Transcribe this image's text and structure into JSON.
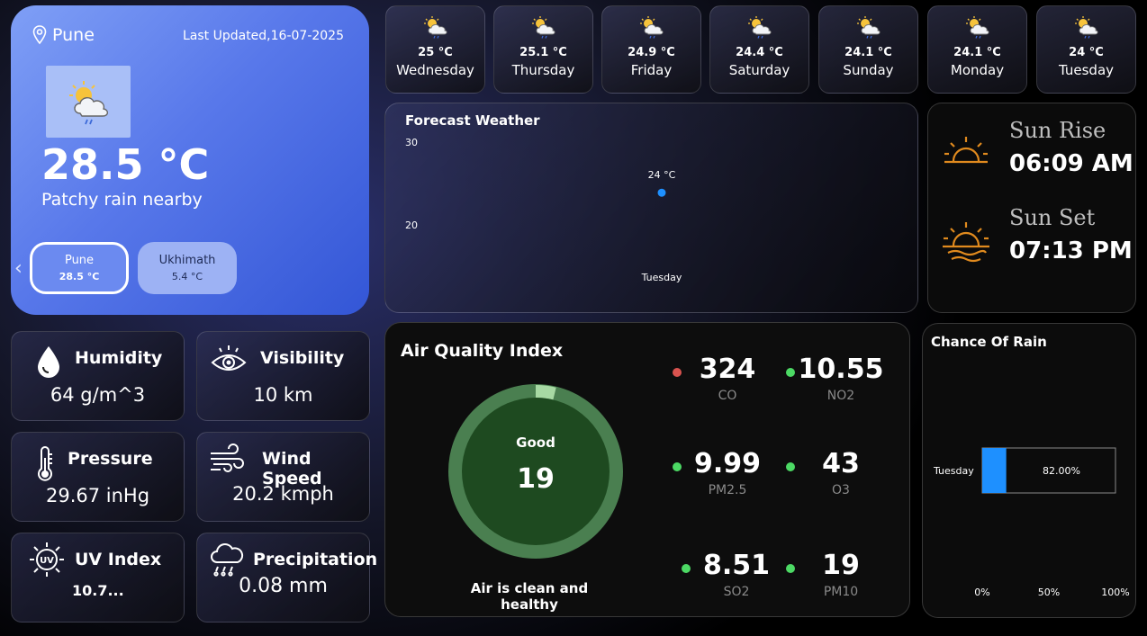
{
  "main": {
    "location": "Pune",
    "last_updated": "Last Updated,16-07-2025",
    "temperature": "28.5 °C",
    "condition": "Patchy rain nearby",
    "cities": [
      {
        "name": "Pune",
        "temp": "28.5 °C"
      },
      {
        "name": "Ukhimath",
        "temp": "5.4 °C"
      }
    ]
  },
  "forecast_days": [
    {
      "temp": "25 °C",
      "day": "Wednesday",
      "icon": "sun-cloud-rain-icon"
    },
    {
      "temp": "25.1 °C",
      "day": "Thursday",
      "icon": "sun-cloud-rain-icon"
    },
    {
      "temp": "24.9 °C",
      "day": "Friday",
      "icon": "sun-cloud-rain-icon"
    },
    {
      "temp": "24.4 °C",
      "day": "Saturday",
      "icon": "sun-cloud-rain-icon"
    },
    {
      "temp": "24.1 °C",
      "day": "Sunday",
      "icon": "sun-cloud-rain-icon"
    },
    {
      "temp": "24.1 °C",
      "day": "Monday",
      "icon": "sun-cloud-rain-icon"
    },
    {
      "temp": "24 °C",
      "day": "Tuesday",
      "icon": "sun-cloud-rain-icon"
    }
  ],
  "forecast_chart": {
    "title": "Forecast Weather"
  },
  "sun": {
    "rise_label": "Sun Rise",
    "rise_time": "06:09 AM",
    "set_label": "Sun Set",
    "set_time": "07:13 PM"
  },
  "stats": [
    {
      "name": "Humidity",
      "value": "64 g/m^3",
      "icon": "droplet-icon"
    },
    {
      "name": "Visibility",
      "value": "10 km",
      "icon": "eye-icon"
    },
    {
      "name": "Pressure",
      "value": "29.67 inHg",
      "icon": "thermometer-icon"
    },
    {
      "name": "Wind Speed",
      "value": "20.2 kmph",
      "icon": "wind-icon"
    },
    {
      "name": "UV Index",
      "value": "10.7...",
      "icon": "uv-sun-icon"
    },
    {
      "name": "Precipitation",
      "value": "0.08 mm",
      "icon": "rain-cloud-icon"
    }
  ],
  "aqi": {
    "title": "Air Quality Index",
    "status": "Good",
    "value": "19",
    "value_num": 19,
    "gauge_max": 500,
    "note": "Air is clean and healthy",
    "pollutants": [
      {
        "value": "324",
        "name": "CO",
        "status_color": "#d9534f"
      },
      {
        "value": "10.55",
        "name": "NO2",
        "status_color": "#4cd964"
      },
      {
        "value": "9.99",
        "name": "PM2.5",
        "status_color": "#4cd964"
      },
      {
        "value": "43",
        "name": "O3",
        "status_color": "#4cd964"
      },
      {
        "value": "8.51",
        "name": "SO2",
        "status_color": "#4cd964"
      },
      {
        "value": "19",
        "name": "PM10",
        "status_color": "#4cd964"
      }
    ]
  },
  "chart_data": [
    {
      "type": "scatter",
      "title": "Forecast Weather",
      "categories": [
        "Tuesday"
      ],
      "values": [
        24
      ],
      "data_labels": [
        "24 °C"
      ],
      "ylim": [
        20,
        30
      ],
      "y_ticks": [
        "30",
        "20"
      ],
      "grid": false
    },
    {
      "type": "bar",
      "orientation": "horizontal",
      "title": "Chance Of Rain",
      "categories": [
        "Tuesday"
      ],
      "values": [
        82
      ],
      "data_labels": [
        "82.00%"
      ],
      "xlim": [
        0,
        100
      ],
      "x_ticks": [
        "0%",
        "50%",
        "100%"
      ],
      "colors": {
        "bar": "#1e90ff",
        "remainder_border": "#8a8a8a"
      }
    }
  ]
}
